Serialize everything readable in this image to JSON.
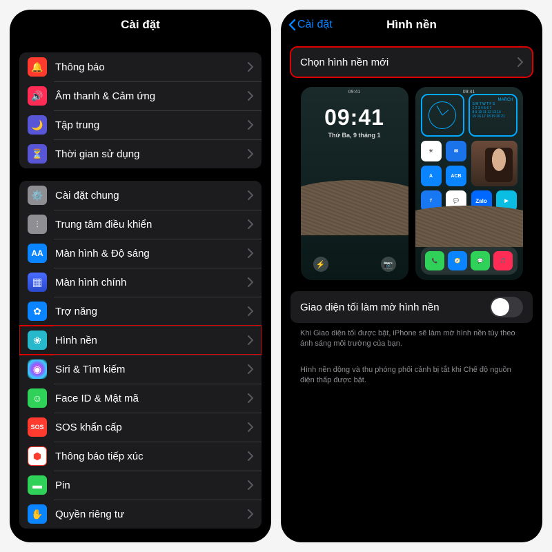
{
  "left": {
    "title": "Cài đặt",
    "group1": [
      {
        "label": "Thông báo",
        "icon": "bell",
        "bg": "#ff3b30"
      },
      {
        "label": "Âm thanh & Cảm ứng",
        "icon": "sound",
        "bg": "#ff2d55"
      },
      {
        "label": "Tập trung",
        "icon": "focus",
        "bg": "#5856d6"
      },
      {
        "label": "Thời gian sử dụng",
        "icon": "screentime",
        "bg": "#5856d6"
      }
    ],
    "group2": [
      {
        "label": "Cài đặt chung",
        "icon": "general",
        "bg": "#8e8e93"
      },
      {
        "label": "Trung tâm điều khiển",
        "icon": "control",
        "bg": "#8e8e93"
      },
      {
        "label": "Màn hình & Độ sáng",
        "icon": "display",
        "bg": "#0a84ff"
      },
      {
        "label": "Màn hình chính",
        "icon": "home",
        "bg": "#3355dd"
      },
      {
        "label": "Trợ năng",
        "icon": "access",
        "bg": "#0a84ff"
      },
      {
        "label": "Hình nền",
        "icon": "wallpaper",
        "bg": "#28b8cc",
        "hl": true
      },
      {
        "label": "Siri & Tìm kiếm",
        "icon": "siri",
        "bg": "#222"
      },
      {
        "label": "Face ID & Mật mã",
        "icon": "faceid",
        "bg": "#30d158"
      },
      {
        "label": "SOS khẩn cấp",
        "icon": "sos",
        "bg": "#ff3b30"
      },
      {
        "label": "Thông báo tiếp xúc",
        "icon": "exposure",
        "bg": "#ff3b30"
      },
      {
        "label": "Pin",
        "icon": "battery",
        "bg": "#30d158"
      },
      {
        "label": "Quyền riêng tư",
        "icon": "privacy",
        "bg": "#0a84ff"
      }
    ]
  },
  "right": {
    "back": "Cài đặt",
    "title": "Hình nền",
    "choose": "Chọn hình nền mới",
    "lock_time": "09:41",
    "lock_date": "Thứ Ba, 9 tháng 1",
    "home_time": "09:41",
    "cal_month": "MARCH",
    "dim_label": "Giao diện tối làm mờ hình nền",
    "dim_desc": "Khi Giao diện tối được bật, iPhone sẽ làm mờ hình nền tùy theo ánh sáng môi trường của bạn.",
    "live_desc": "Hình nền động và thu phóng phối cảnh bị tắt khi Chế độ nguồn điện thấp được bật."
  },
  "icons": {
    "bell": "🔔",
    "sound": "🔊",
    "focus": "🌙",
    "screentime": "⏳",
    "general": "⚙️",
    "control": "⫶",
    "display": "AA",
    "home": "▦",
    "access": "✿",
    "wallpaper": "❀",
    "siri": "◉",
    "faceid": "☺",
    "sos": "SOS",
    "exposure": "⬢",
    "battery": "▬",
    "privacy": "✋"
  }
}
